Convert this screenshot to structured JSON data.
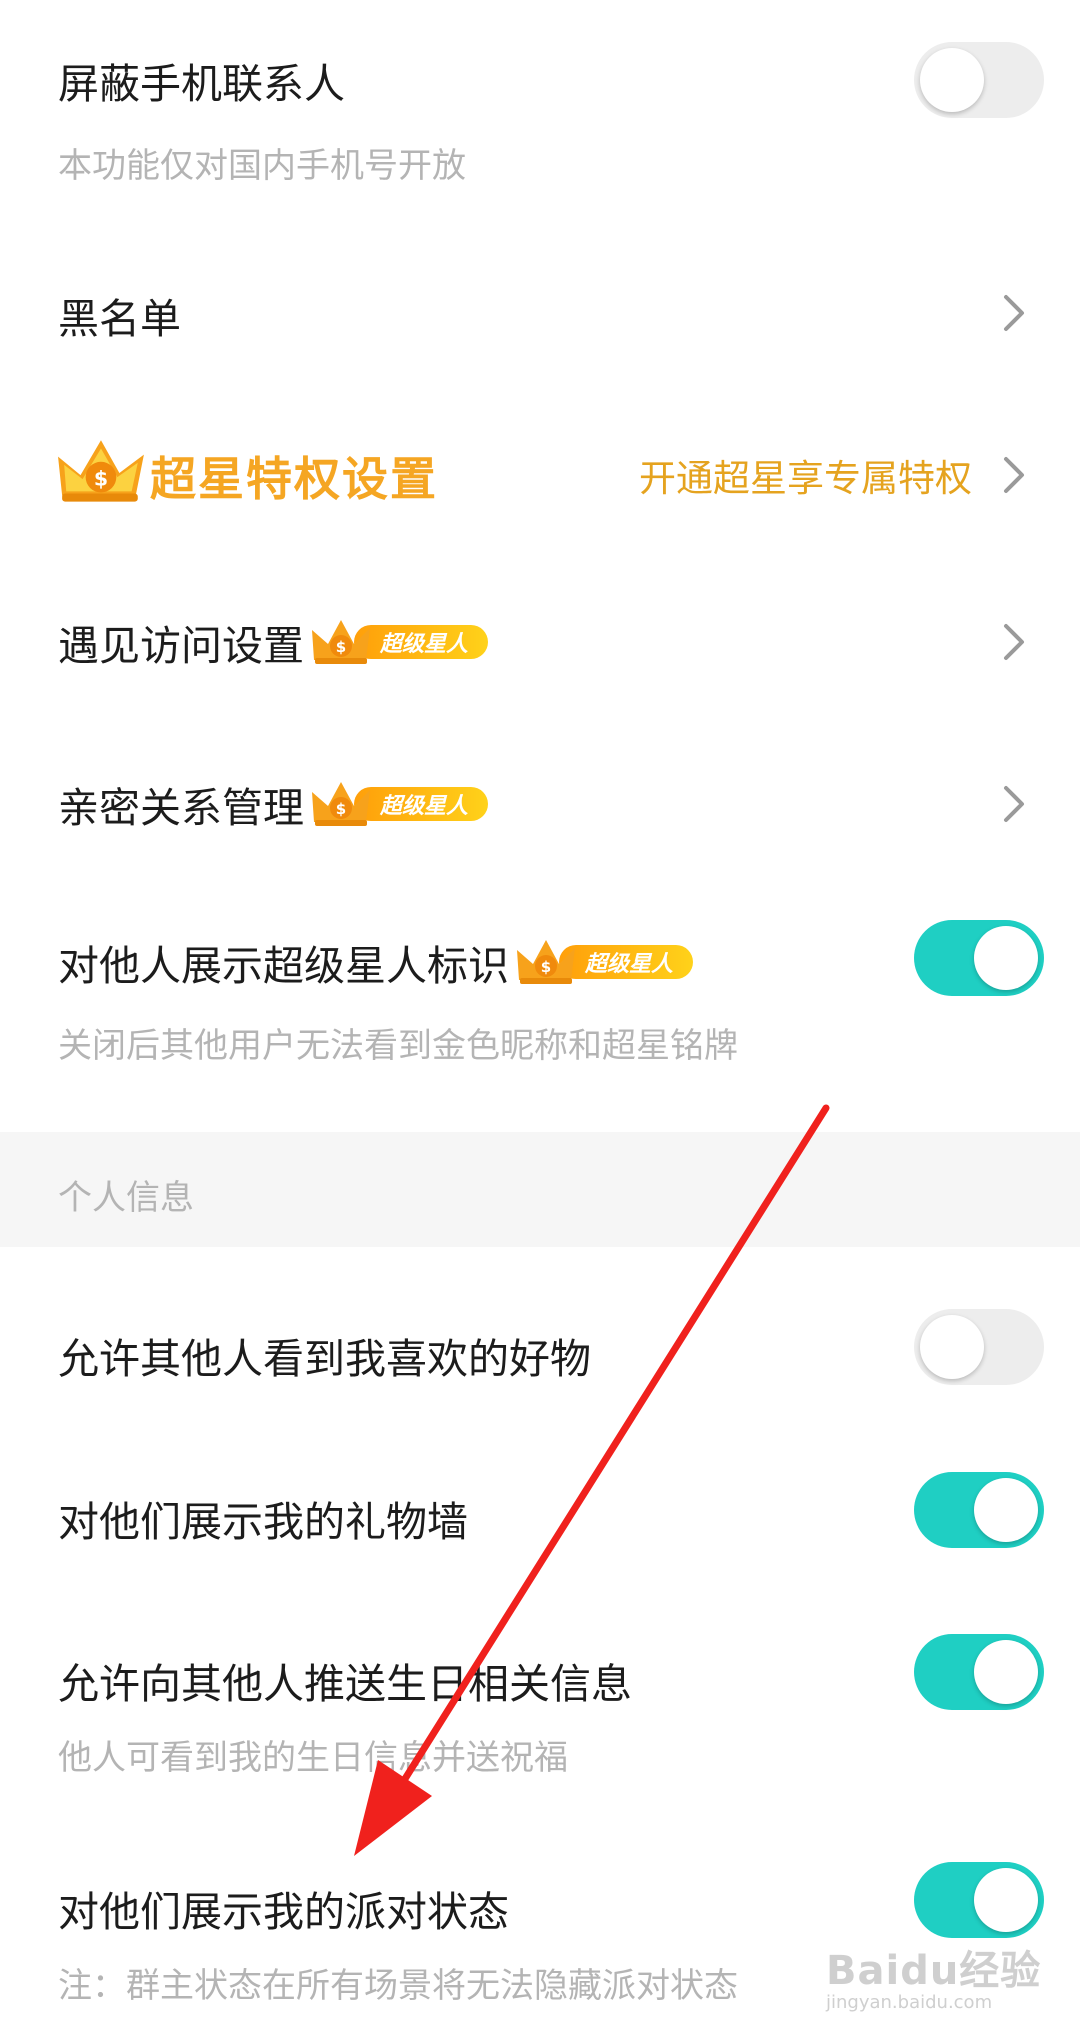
{
  "settings": {
    "block_contacts": {
      "title": "屏蔽手机联系人",
      "subtitle": "本功能仅对国内手机号开放",
      "state": "off"
    },
    "blacklist": {
      "title": "黑名单"
    },
    "vip": {
      "title": "超星特权设置",
      "link": "开通超星享专属特权"
    },
    "encounter_visit": {
      "title": "遇见访问设置",
      "badge": "超级星人"
    },
    "intimacy": {
      "title": "亲密关系管理",
      "badge": "超级星人"
    },
    "show_superstar": {
      "title": "对他人展示超级星人标识",
      "badge": "超级星人",
      "subtitle": "关闭后其他用户无法看到金色昵称和超星铭牌",
      "state": "on"
    }
  },
  "section": {
    "label": "个人信息"
  },
  "personal": {
    "goods": {
      "title": "允许其他人看到我喜欢的好物",
      "state": "off"
    },
    "gift_wall": {
      "title": "对他们展示我的礼物墙",
      "state": "on"
    },
    "birthday": {
      "title": "允许向其他人推送生日相关信息",
      "subtitle": "他人可看到我的生日信息并送祝福",
      "state": "on"
    },
    "party": {
      "title": "对他们展示我的派对状态",
      "subtitle": "注：群主状态在所有场景将无法隐藏派对状态",
      "state": "on"
    }
  },
  "watermark": {
    "brand": "Baidu经验",
    "url": "jingyan.baidu.com"
  },
  "colors": {
    "accent": "#1fcfc3",
    "gold": "#f5a623",
    "annotation_arrow": "#f0211d"
  }
}
